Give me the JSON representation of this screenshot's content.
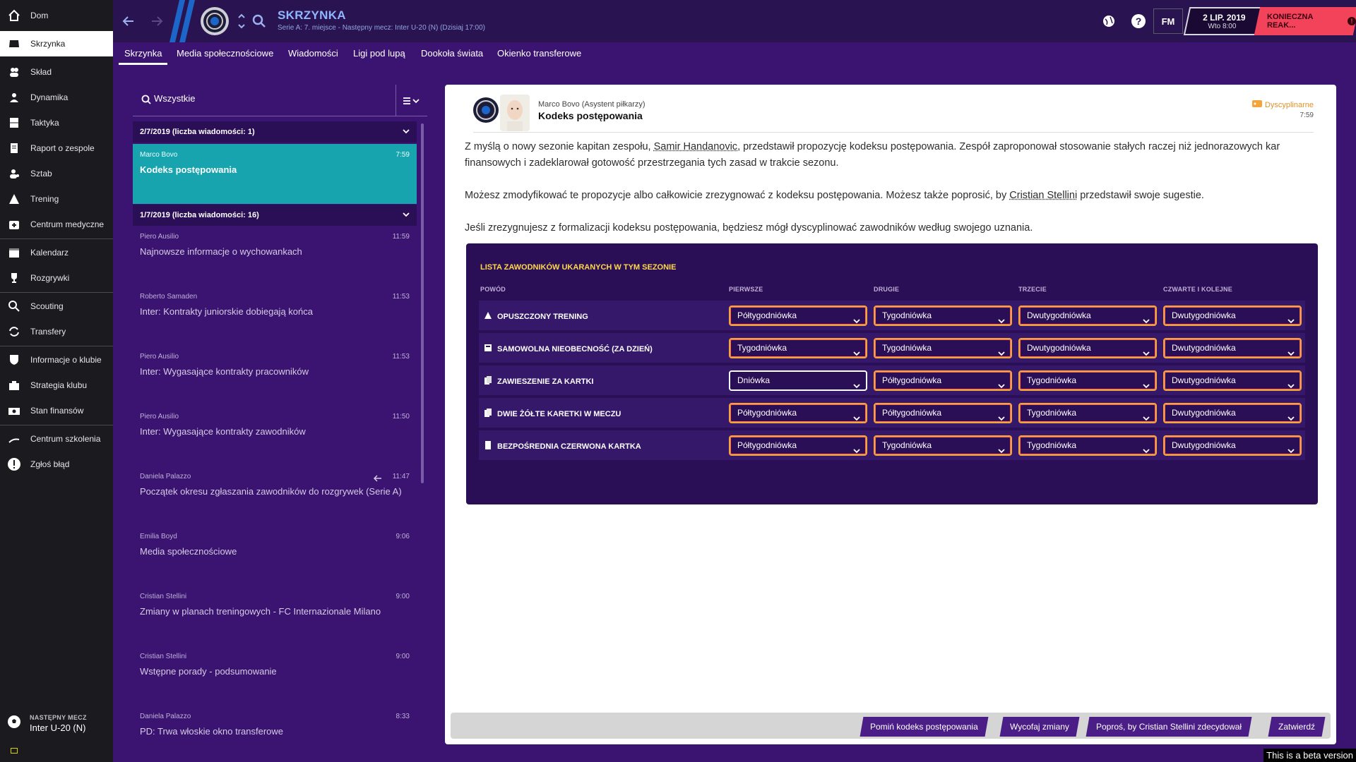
{
  "sidebar": {
    "items": [
      {
        "label": "Dom",
        "icon": "home-icon"
      },
      {
        "label": "Skrzynka",
        "icon": "inbox-icon",
        "active": true
      },
      {
        "label": "Skład",
        "icon": "squad-icon"
      },
      {
        "label": "Dynamika",
        "icon": "dynamics-icon"
      },
      {
        "label": "Taktyka",
        "icon": "tactics-icon"
      },
      {
        "label": "Raport o zespole",
        "icon": "report-icon"
      },
      {
        "label": "Sztab",
        "icon": "staff-icon"
      },
      {
        "label": "Trening",
        "icon": "training-icon"
      },
      {
        "label": "Centrum medyczne",
        "icon": "medical-icon"
      },
      {
        "label": "Kalendarz",
        "icon": "calendar-icon"
      },
      {
        "label": "Rozgrywki",
        "icon": "trophy-icon"
      },
      {
        "label": "Scouting",
        "icon": "scouting-icon"
      },
      {
        "label": "Transfery",
        "icon": "transfers-icon"
      },
      {
        "label": "Informacje o klubie",
        "icon": "club-icon"
      },
      {
        "label": "Strategia klubu",
        "icon": "strategy-icon"
      },
      {
        "label": "Stan finansów",
        "icon": "finances-icon"
      },
      {
        "label": "Centrum szkolenia",
        "icon": "youth-icon"
      },
      {
        "label": "Zgłoś błąd",
        "icon": "alert-icon"
      }
    ],
    "next_match": {
      "label": "NASTĘPNY MECZ",
      "value": "Inter U-20 (N)"
    }
  },
  "topbar": {
    "title": "SKRZYNKA",
    "subtitle": "Serie A: 7. miejsce - Następny mecz: Inter U-20 (N) (Dzisiaj 17:00)",
    "fm_label": "FM",
    "date_main": "2 LIP. 2019",
    "date_sub": "Wto 8:00",
    "continue_label": "KONIECZNA REAK...",
    "continue_warn": "!",
    "help_label": "?"
  },
  "tabs": [
    "Skrzynka",
    "Media społecznościowe",
    "Wiadomości",
    "Ligi pod lupą",
    "Dookoła świata",
    "Okienko transferowe"
  ],
  "list": {
    "filter": "Wszystkie",
    "groups": [
      {
        "header": "2/7/2019 (liczba wiadomości: 1)"
      },
      {
        "header": "1/7/2019 (liczba wiadomości: 16)"
      }
    ],
    "messages": [
      {
        "sender": "Marco Bovo",
        "time": "7:59",
        "subject": "Kodeks postępowania"
      },
      {
        "sender": "Piero Ausilio",
        "time": "11:59",
        "subject": "Najnowsze informacje o wychowankach"
      },
      {
        "sender": "Roberto Samaden",
        "time": "11:53",
        "subject": "Inter: Kontrakty juniorskie dobiegają końca"
      },
      {
        "sender": "Piero Ausilio",
        "time": "11:53",
        "subject": "Inter: Wygasające kontrakty pracowników"
      },
      {
        "sender": "Piero Ausilio",
        "time": "11:50",
        "subject": "Inter: Wygasające kontrakty zawodników"
      },
      {
        "sender": "Daniela Palazzo",
        "time": "11:47",
        "subject": "Początek okresu zgłaszania zawodników do rozgrywek (Serie A)"
      },
      {
        "sender": "Emilia Boyd",
        "time": "9:06",
        "subject": "Media społecznościowe"
      },
      {
        "sender": "Cristian Stellini",
        "time": "9:00",
        "subject": "Zmiany w planach treningowych - FC Internazionale Milano"
      },
      {
        "sender": "Cristian Stellini",
        "time": "9:00",
        "subject": "Wstępne porady - podsumowanie"
      },
      {
        "sender": "Daniela Palazzo",
        "time": "8:33",
        "subject": "PD: Trwa włoskie okno transferowe"
      }
    ]
  },
  "message": {
    "sender": "Marco Bovo  (Asystent piłkarzy)",
    "subject": "Kodeks postępowania",
    "category": "Dyscyplinarne",
    "time": "7:59",
    "p1_a": "Z myślą o nowy sezonie kapitan zespołu, ",
    "p1_name": "Samir Handanovic",
    "p1_b": ", przedstawił propozycję kodeksu postępowania. Zespół zaproponował stosowanie stałych raczej niż jednorazowych kar finansowych i zadeklarował gotowość przestrzegania tych zasad w trakcie sezonu.",
    "p2_a": "Możesz zmodyfikować te propozycje albo całkowicie zrezygnować z kodeksu postępowania. Możesz także poprosić, by ",
    "p2_name": "Cristian Stellini",
    "p2_b": " przedstawił swoje sugestie.",
    "p3": "Jeśli zrezygnujesz z formalizacji kodeksu postępowania, będziesz mógł dyscyplinować zawodników według swojego uznania."
  },
  "discipline": {
    "title": "LISTA ZAWODNIKÓW UKARANYCH W TYM SEZONIE",
    "columns": [
      "POWÓD",
      "PIERWSZE",
      "DRUGIE",
      "TRZECIE",
      "CZWARTE I KOLEJNE"
    ],
    "rows": [
      {
        "reason": "OPUSZCZONY TRENING",
        "icon": "missed-training-icon",
        "values": [
          "Półtygodniówka",
          "Tygodniówka",
          "Dwutygodniówka",
          "Dwutygodniówka"
        ]
      },
      {
        "reason": "SAMOWOLNA NIEOBECNOŚĆ (ZA DZIEŃ)",
        "icon": "absence-icon",
        "values": [
          "Tygodniówka",
          "Tygodniówka",
          "Dwutygodniówka",
          "Dwutygodniówka"
        ]
      },
      {
        "reason": "ZAWIESZENIE ZA KARTKI",
        "icon": "cards-icon",
        "values": [
          "Dniówka",
          "Półtygodniówka",
          "Tygodniówka",
          "Dwutygodniówka"
        ]
      },
      {
        "reason": "DWIE ŻÓŁTE KARETKI W MECZU",
        "icon": "yellow-cards-icon",
        "values": [
          "Półtygodniówka",
          "Półtygodniówka",
          "Tygodniówka",
          "Dwutygodniówka"
        ]
      },
      {
        "reason": "BEZPOŚREDNIA CZERWONA KARTKA",
        "icon": "red-card-icon",
        "values": [
          "Półtygodniówka",
          "Tygodniówka",
          "Tygodniówka",
          "Dwutygodniówka"
        ]
      }
    ]
  },
  "footer": {
    "skip": "Pomiń kodeks postępowania",
    "undo": "Wycofaj zmiany",
    "ask": "Poproś, by Cristian Stellini zdecydował",
    "confirm": "Zatwierdź"
  },
  "beta_label": "This is a beta version",
  "colors": {
    "accent": "#17a4ae",
    "brand": "#3a1470",
    "warning": "#f2435a",
    "title_yellow": "#ffd84a"
  }
}
